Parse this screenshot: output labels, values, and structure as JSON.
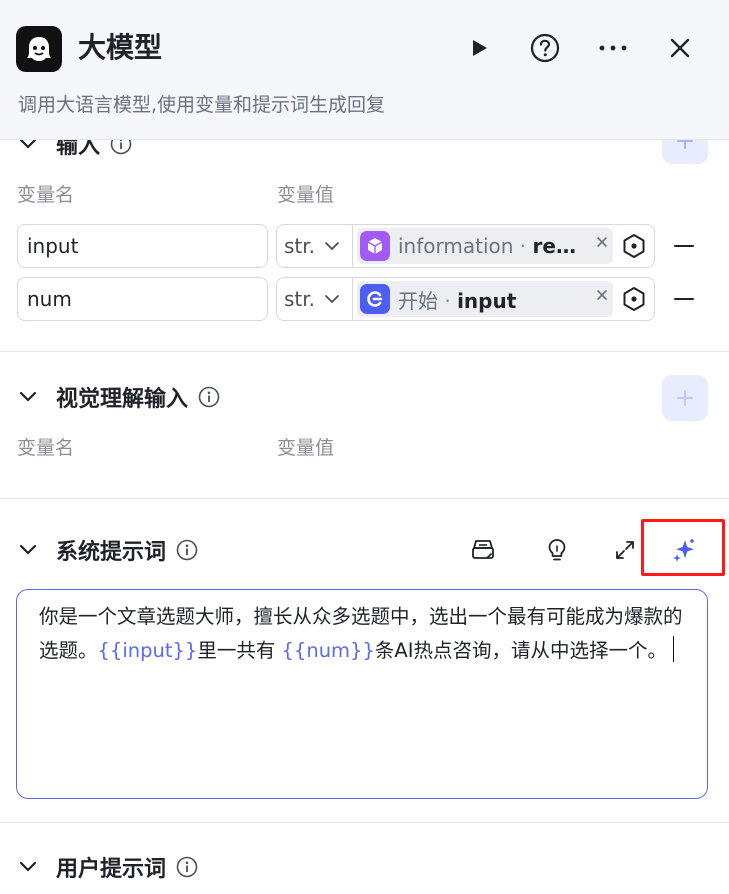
{
  "header": {
    "title": "大模型",
    "subtitle": "调用大语言模型,使用变量和提示词生成回复",
    "icons": [
      "play-icon",
      "help-icon",
      "more-icon",
      "close-icon"
    ]
  },
  "input_section": {
    "title": "输入",
    "col_name": "变量名",
    "col_value": "变量值",
    "rows": [
      {
        "name": "input",
        "type": "str.",
        "node": "information",
        "sep": " · ",
        "var": "re…",
        "node_color": "#a25af5"
      },
      {
        "name": "num",
        "type": "str.",
        "node": "开始",
        "sep": " · ",
        "var": "input",
        "node_color": "#4d5ef0"
      }
    ]
  },
  "vision_section": {
    "title": "视觉理解输入",
    "col_name": "变量名",
    "col_value": "变量值"
  },
  "system_prompt": {
    "title": "系统提示词",
    "text_1": "你是一个文章选题大师，擅长从众多选题中，选出一个最有可能成为爆款的选题。",
    "var_1": "{{input}}",
    "text_2": "里一共有 ",
    "var_2": "{{num}}",
    "text_3": "条AI热点咨询，请从中选择一个。"
  },
  "user_prompt": {
    "title": "用户提示词"
  },
  "colors": {
    "accent": "#4d5ef0",
    "highlight": "#ff1a1a",
    "info_node": "#a25af5"
  }
}
